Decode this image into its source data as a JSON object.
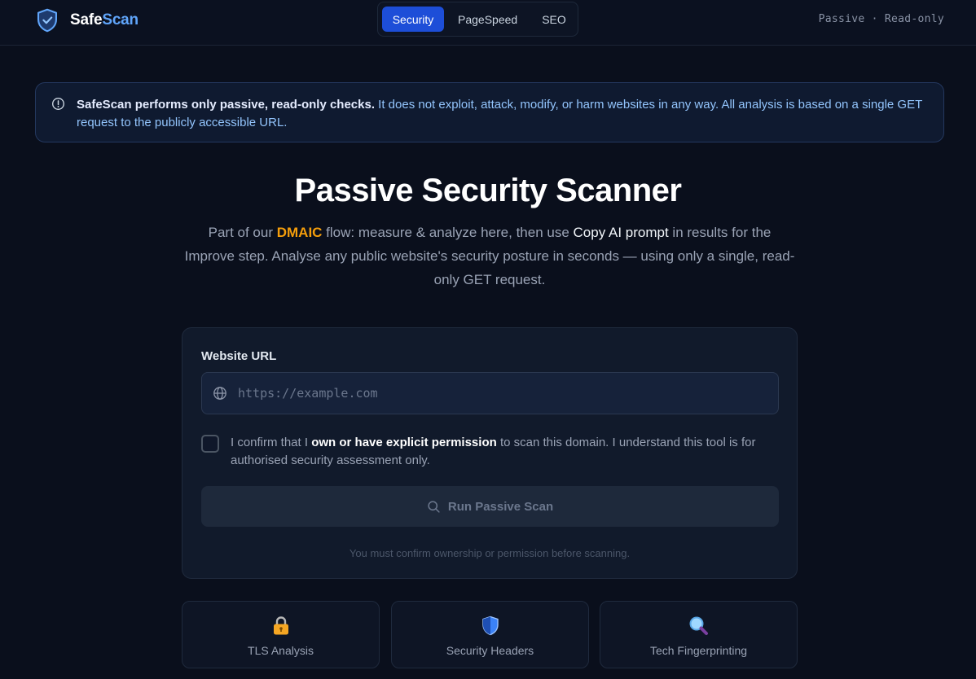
{
  "header": {
    "brand_part1": "Safe",
    "brand_part2": "Scan",
    "tabs": [
      {
        "label": "Security",
        "active": true
      },
      {
        "label": "PageSpeed",
        "active": false
      },
      {
        "label": "SEO",
        "active": false
      }
    ],
    "mode": "Passive · Read-only"
  },
  "notice": {
    "bold": "SafeScan performs only passive, read-only checks.",
    "text": " It does not exploit, attack, modify, or harm websites in any way. All analysis is based on a single GET request to the publicly accessible URL."
  },
  "hero": {
    "title": "Passive Security Scanner",
    "desc_1": "Part of our ",
    "desc_highlight": "DMAIC",
    "desc_2": " flow: measure & analyze here, then use ",
    "desc_emphasis": "Copy AI prompt",
    "desc_3": " in results for the Improve step. Analyse any public website's security posture in seconds — using only a single, read-only GET request."
  },
  "form": {
    "url_label": "Website URL",
    "url_placeholder": "https://example.com",
    "url_value": "",
    "confirm_1": "I confirm that I ",
    "confirm_bold": "own or have explicit permission",
    "confirm_2": " to scan this domain. I understand this tool is for authorised security assessment only.",
    "confirmed": false,
    "run_label": "Run Passive Scan",
    "hint": "You must confirm ownership or permission before scanning."
  },
  "features": [
    {
      "icon": "lock-icon",
      "label": "TLS Analysis"
    },
    {
      "icon": "shield-icon",
      "label": "Security Headers"
    },
    {
      "icon": "magnifier-icon",
      "label": "Tech Fingerprinting"
    }
  ],
  "colors": {
    "background": "#0a0f1c",
    "accent": "#1d4ed8",
    "brand_blue": "#60a5fa",
    "highlight": "#f59e0b"
  }
}
